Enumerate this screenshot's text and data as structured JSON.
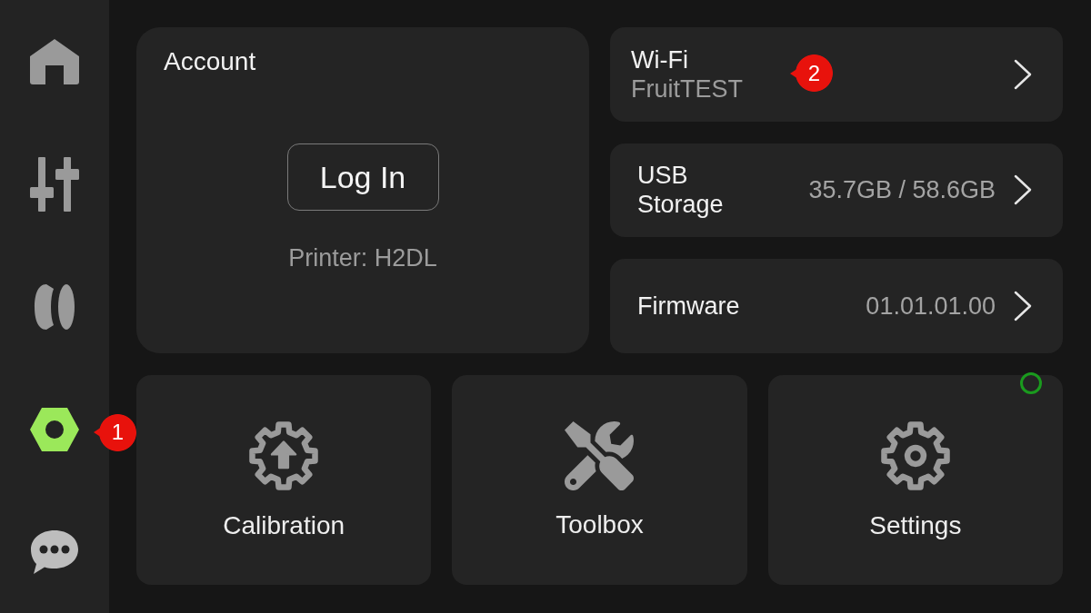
{
  "sidebar": {
    "items": [
      {
        "selected": false
      },
      {
        "selected": false
      },
      {
        "selected": false
      },
      {
        "selected": true,
        "callout": "1"
      },
      {
        "selected": false
      }
    ]
  },
  "account": {
    "title": "Account",
    "button": "Log In",
    "printer": "Printer: H2DL"
  },
  "info_rows": [
    {
      "kind": "network",
      "title": "Wi-Fi",
      "subtitle": "FruitTEST",
      "callout": "2"
    },
    {
      "kind": "value",
      "title": "USB Storage",
      "value": "35.7GB / 58.6GB"
    },
    {
      "kind": "value",
      "title": "Firmware",
      "value": "01.01.01.00"
    }
  ],
  "tiles": [
    {
      "label": "Calibration",
      "indicator": false
    },
    {
      "label": "Toolbox",
      "indicator": false
    },
    {
      "label": "Settings",
      "indicator": true
    }
  ]
}
